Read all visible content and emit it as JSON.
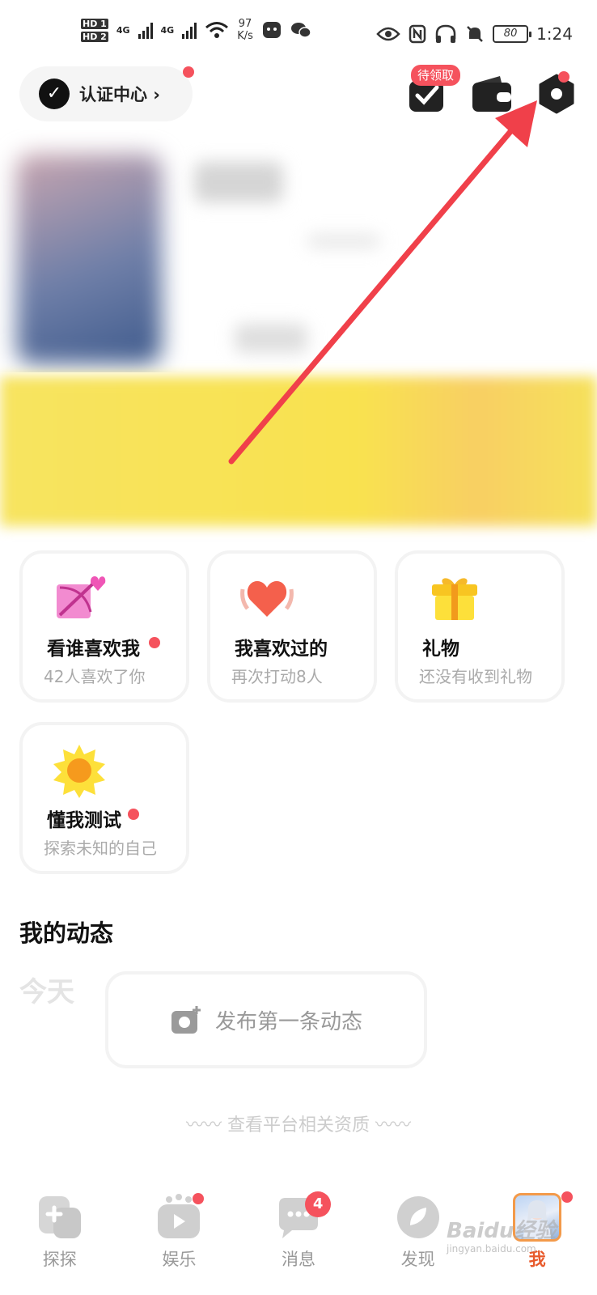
{
  "status_bar": {
    "sim1": "HD 1",
    "sim2": "HD 2",
    "net1": "4G",
    "net2": "4G",
    "speed_value": "97",
    "speed_unit": "K/s",
    "battery": "80",
    "time": "1:24"
  },
  "header": {
    "auth_center_label": "认证中心 ›",
    "pending_badge": "待领取"
  },
  "features": [
    {
      "title": "看谁喜欢我",
      "subtitle": "42人喜欢了你",
      "has_dot": true
    },
    {
      "title": "我喜欢过的",
      "subtitle": "再次打动8人",
      "has_dot": false
    },
    {
      "title": "礼物",
      "subtitle": "还没有收到礼物",
      "has_dot": false
    },
    {
      "title": "懂我测试",
      "subtitle": "探索未知的自己",
      "has_dot": true
    }
  ],
  "moments": {
    "section_title": "我的动态",
    "today_label": "今天",
    "post_first": "发布第一条动态"
  },
  "footer": {
    "qualification": "〰〰 查看平台相关资质 〰〰"
  },
  "bottom_nav": {
    "items": [
      {
        "label": "探探"
      },
      {
        "label": "娱乐"
      },
      {
        "label": "消息",
        "badge": "4"
      },
      {
        "label": "发现"
      },
      {
        "label": "我"
      }
    ]
  },
  "watermark": {
    "brand": "Baidu经验",
    "url": "jingyan.baidu.com"
  },
  "colors": {
    "accent_red": "#f5525d",
    "arrow_red": "#f0404a",
    "banner_yellow": "#f9e24f",
    "active_tab": "#e85a2c"
  }
}
